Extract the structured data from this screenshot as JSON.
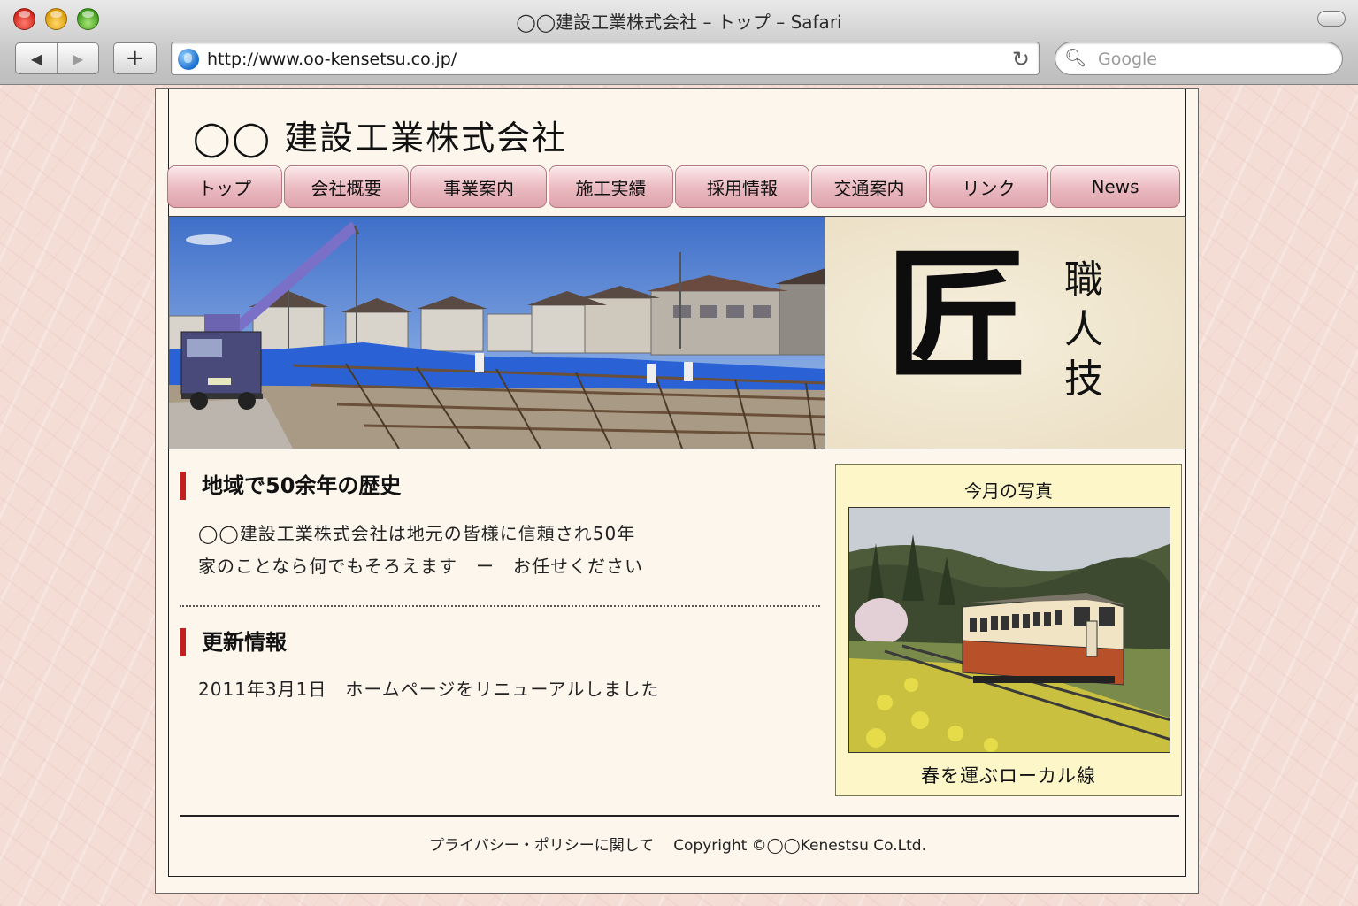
{
  "window": {
    "title": "◯◯建設工業株式会社 – トップ – Safari",
    "url": "http://www.oo-kensetsu.co.jp/",
    "search_placeholder": "Google"
  },
  "toolbar": {
    "back_glyph": "◀",
    "forward_glyph": "▶",
    "add_glyph": "+",
    "reload_glyph": "↻",
    "search_glyph": "🔍︎"
  },
  "site": {
    "title": "◯◯ 建設工業株式会社"
  },
  "nav": {
    "items": [
      {
        "label": "トップ"
      },
      {
        "label": "会社概要"
      },
      {
        "label": "事業案内"
      },
      {
        "label": "施工実績"
      },
      {
        "label": "採用情報"
      },
      {
        "label": "交通案内"
      },
      {
        "label": "リンク"
      },
      {
        "label": "News"
      }
    ]
  },
  "hero": {
    "kanji_big": "匠",
    "kanji_small": [
      "職",
      "人",
      "技"
    ]
  },
  "history": {
    "heading": "地域で50余年の歴史",
    "line1": "◯◯建設工業株式会社は地元の皆様に信頼され50年",
    "line2": "家のことなら何でもそろえます　ー　お任せください"
  },
  "updates": {
    "heading": "更新情報",
    "line1": "2011年3月1日　ホームページをリニューアルしました"
  },
  "photo_of_month": {
    "title": "今月の写真",
    "caption": "春を運ぶローカル線"
  },
  "footer": {
    "privacy": "プライバシー・ポリシーに関して",
    "copyright": "Copyright ©◯◯Kenestsu Co.Ltd."
  },
  "colors": {
    "accent_red": "#c21f1f",
    "nav_pink": "#eab8bf",
    "page_bg": "#fcf6ec",
    "photo_box_bg": "#fdf6c9"
  }
}
